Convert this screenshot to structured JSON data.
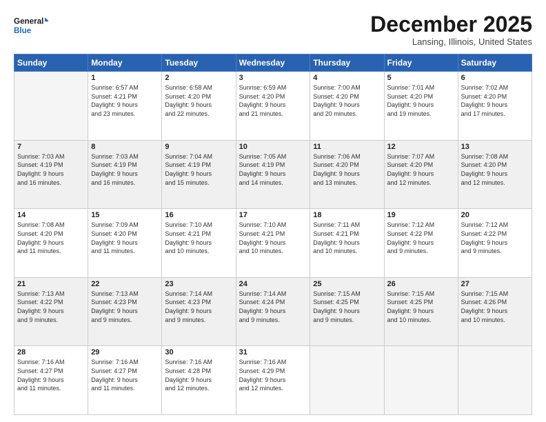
{
  "logo": {
    "text_general": "General",
    "text_blue": "Blue"
  },
  "header": {
    "title": "December 2025",
    "subtitle": "Lansing, Illinois, United States"
  },
  "days_of_week": [
    "Sunday",
    "Monday",
    "Tuesday",
    "Wednesday",
    "Thursday",
    "Friday",
    "Saturday"
  ],
  "weeks": [
    [
      {
        "day": "",
        "info": ""
      },
      {
        "day": "1",
        "info": "Sunrise: 6:57 AM\nSunset: 4:21 PM\nDaylight: 9 hours\nand 23 minutes."
      },
      {
        "day": "2",
        "info": "Sunrise: 6:58 AM\nSunset: 4:20 PM\nDaylight: 9 hours\nand 22 minutes."
      },
      {
        "day": "3",
        "info": "Sunrise: 6:59 AM\nSunset: 4:20 PM\nDaylight: 9 hours\nand 21 minutes."
      },
      {
        "day": "4",
        "info": "Sunrise: 7:00 AM\nSunset: 4:20 PM\nDaylight: 9 hours\nand 20 minutes."
      },
      {
        "day": "5",
        "info": "Sunrise: 7:01 AM\nSunset: 4:20 PM\nDaylight: 9 hours\nand 19 minutes."
      },
      {
        "day": "6",
        "info": "Sunrise: 7:02 AM\nSunset: 4:20 PM\nDaylight: 9 hours\nand 17 minutes."
      }
    ],
    [
      {
        "day": "7",
        "info": "Sunrise: 7:03 AM\nSunset: 4:19 PM\nDaylight: 9 hours\nand 16 minutes."
      },
      {
        "day": "8",
        "info": "Sunrise: 7:03 AM\nSunset: 4:19 PM\nDaylight: 9 hours\nand 16 minutes."
      },
      {
        "day": "9",
        "info": "Sunrise: 7:04 AM\nSunset: 4:19 PM\nDaylight: 9 hours\nand 15 minutes."
      },
      {
        "day": "10",
        "info": "Sunrise: 7:05 AM\nSunset: 4:19 PM\nDaylight: 9 hours\nand 14 minutes."
      },
      {
        "day": "11",
        "info": "Sunrise: 7:06 AM\nSunset: 4:20 PM\nDaylight: 9 hours\nand 13 minutes."
      },
      {
        "day": "12",
        "info": "Sunrise: 7:07 AM\nSunset: 4:20 PM\nDaylight: 9 hours\nand 12 minutes."
      },
      {
        "day": "13",
        "info": "Sunrise: 7:08 AM\nSunset: 4:20 PM\nDaylight: 9 hours\nand 12 minutes."
      }
    ],
    [
      {
        "day": "14",
        "info": "Sunrise: 7:08 AM\nSunset: 4:20 PM\nDaylight: 9 hours\nand 11 minutes."
      },
      {
        "day": "15",
        "info": "Sunrise: 7:09 AM\nSunset: 4:20 PM\nDaylight: 9 hours\nand 11 minutes."
      },
      {
        "day": "16",
        "info": "Sunrise: 7:10 AM\nSunset: 4:21 PM\nDaylight: 9 hours\nand 10 minutes."
      },
      {
        "day": "17",
        "info": "Sunrise: 7:10 AM\nSunset: 4:21 PM\nDaylight: 9 hours\nand 10 minutes."
      },
      {
        "day": "18",
        "info": "Sunrise: 7:11 AM\nSunset: 4:21 PM\nDaylight: 9 hours\nand 10 minutes."
      },
      {
        "day": "19",
        "info": "Sunrise: 7:12 AM\nSunset: 4:22 PM\nDaylight: 9 hours\nand 9 minutes."
      },
      {
        "day": "20",
        "info": "Sunrise: 7:12 AM\nSunset: 4:22 PM\nDaylight: 9 hours\nand 9 minutes."
      }
    ],
    [
      {
        "day": "21",
        "info": "Sunrise: 7:13 AM\nSunset: 4:22 PM\nDaylight: 9 hours\nand 9 minutes."
      },
      {
        "day": "22",
        "info": "Sunrise: 7:13 AM\nSunset: 4:23 PM\nDaylight: 9 hours\nand 9 minutes."
      },
      {
        "day": "23",
        "info": "Sunrise: 7:14 AM\nSunset: 4:23 PM\nDaylight: 9 hours\nand 9 minutes."
      },
      {
        "day": "24",
        "info": "Sunrise: 7:14 AM\nSunset: 4:24 PM\nDaylight: 9 hours\nand 9 minutes."
      },
      {
        "day": "25",
        "info": "Sunrise: 7:15 AM\nSunset: 4:25 PM\nDaylight: 9 hours\nand 9 minutes."
      },
      {
        "day": "26",
        "info": "Sunrise: 7:15 AM\nSunset: 4:25 PM\nDaylight: 9 hours\nand 10 minutes."
      },
      {
        "day": "27",
        "info": "Sunrise: 7:15 AM\nSunset: 4:26 PM\nDaylight: 9 hours\nand 10 minutes."
      }
    ],
    [
      {
        "day": "28",
        "info": "Sunrise: 7:16 AM\nSunset: 4:27 PM\nDaylight: 9 hours\nand 11 minutes."
      },
      {
        "day": "29",
        "info": "Sunrise: 7:16 AM\nSunset: 4:27 PM\nDaylight: 9 hours\nand 11 minutes."
      },
      {
        "day": "30",
        "info": "Sunrise: 7:16 AM\nSunset: 4:28 PM\nDaylight: 9 hours\nand 12 minutes."
      },
      {
        "day": "31",
        "info": "Sunrise: 7:16 AM\nSunset: 4:29 PM\nDaylight: 9 hours\nand 12 minutes."
      },
      {
        "day": "",
        "info": ""
      },
      {
        "day": "",
        "info": ""
      },
      {
        "day": "",
        "info": ""
      }
    ]
  ]
}
